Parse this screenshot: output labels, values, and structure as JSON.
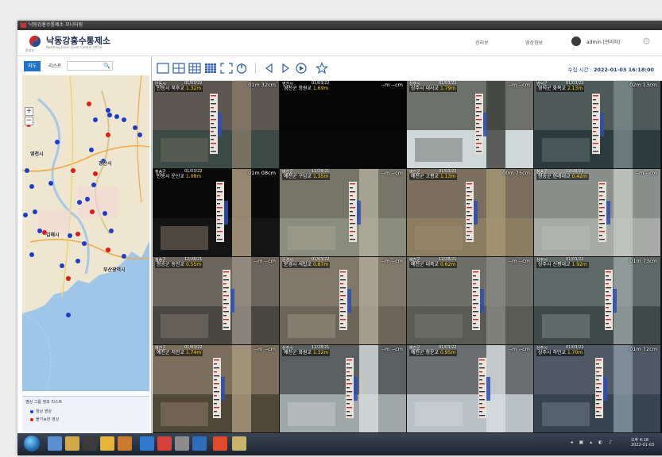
{
  "window": {
    "title": "낙동강홍수통제소 모니터링"
  },
  "header": {
    "org_name": "낙동강홍수통제소",
    "org_name_en": "Nakdong River Flood Control Office",
    "logo_caption": "환경부",
    "nav": [
      "관리보",
      "영상정보"
    ],
    "user": "admin [관리자]"
  },
  "sidebar": {
    "tabs": [
      "지도",
      "리스트"
    ],
    "search_placeholder": "",
    "map_labels": [
      {
        "text": "영천시"
      },
      {
        "text": "경산시"
      },
      {
        "text": "김해시"
      },
      {
        "text": "부산광역시"
      }
    ],
    "zoom_in": "+",
    "zoom_out": "−",
    "legend": {
      "title": "영상 그룹 정보 리스트",
      "items": [
        {
          "label": "정상 영상",
          "color": "#1c3ccc"
        },
        {
          "label": "불가능한 영상",
          "color": "#e01818"
        }
      ]
    }
  },
  "toolbar": {
    "timestamp_label": "수집 시간 :",
    "timestamp_value": "2022-01-03 16:18:00"
  },
  "cameras": [
    {
      "region": "안동시",
      "date": "01/03/22",
      "level": "01m 32cm",
      "name": "안동시 북후교",
      "value": "1.32m",
      "scene": "bridge"
    },
    {
      "region": "영천시",
      "date": "01/03/22",
      "level": "--m --cm",
      "name": "영천군 창원교",
      "value": "1.69m",
      "scene": "night"
    },
    {
      "region": "상주시",
      "date": "01/03/22",
      "level": "--m --cm",
      "name": "상주시 대사교",
      "value": "1.79m",
      "scene": "ice"
    },
    {
      "region": "영덕군",
      "date": "01/03/22",
      "level": "02m 13cm",
      "name": "영덕군 화목교",
      "value": "2.13m",
      "scene": "river"
    },
    {
      "region": "청송군",
      "date": "01/03/22",
      "level": "01m 08cm",
      "name": "안동시 운산교",
      "value": "1.08m",
      "scene": "night2"
    },
    {
      "region": "예천군",
      "date": "12/28/21",
      "level": "--m --cm",
      "name": "예천군 구담교",
      "value": "1.35m",
      "scene": "pillar"
    },
    {
      "region": "예천군",
      "date": "01/03/22",
      "level": "00m 75cm",
      "name": "예천군 고평교",
      "value": "1.13m",
      "scene": "sand"
    },
    {
      "region": "청송군",
      "date": "12/28/21",
      "level": "--m --cm",
      "name": "청송군 현래대교",
      "value": "0.42m",
      "scene": "frost"
    },
    {
      "region": "청송군",
      "date": "12/28/21",
      "level": "--m --cm",
      "name": "청송군 동진교",
      "value": "0.55m",
      "scene": "rocks"
    },
    {
      "region": "문경시",
      "date": "01/03/22",
      "level": "--m --cm",
      "name": "문경시 석탑교",
      "value": "0.87m",
      "scene": "pillar2"
    },
    {
      "region": "예천군",
      "date": "12/28/21",
      "level": "--m --cm",
      "name": "예천군 대죽교",
      "value": "0.62m",
      "scene": "grey"
    },
    {
      "region": "상주시",
      "date": "01/03/22",
      "level": "01m 73cm",
      "name": "상주시 신평대교",
      "value": "1.92m",
      "scene": "river2"
    },
    {
      "region": "예천군",
      "date": "01/03/22",
      "level": "--m --cm",
      "name": "예천군 저전교",
      "value": "1.74m",
      "scene": "sand2"
    },
    {
      "region": "상주시",
      "date": "12/28/21",
      "level": "--m --cm",
      "name": "예천군 화원교",
      "value": "1.32m",
      "scene": "splash"
    },
    {
      "region": "예천군",
      "date": "01/03/22",
      "level": "--m --cm",
      "name": "예천군 청운교",
      "value": "0.95m",
      "scene": "ice2"
    },
    {
      "region": "상주시",
      "date": "01/03/22",
      "level": "01m 72cm",
      "name": "상주시 하만교",
      "value": "1.70m",
      "scene": "river3"
    }
  ],
  "taskbar": {
    "clock_time": "오후 4:18",
    "clock_date": "2022-01-03"
  }
}
